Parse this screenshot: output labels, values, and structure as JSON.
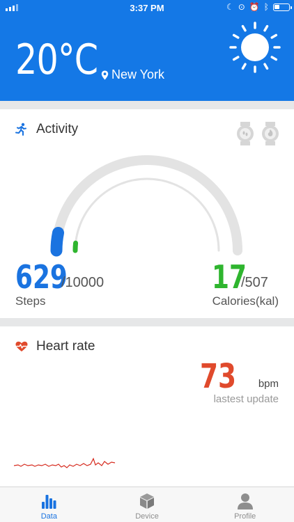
{
  "status_bar": {
    "time": "3:37 PM"
  },
  "weather": {
    "temperature": "20°C",
    "city": "New York"
  },
  "activity": {
    "title": "Activity",
    "steps": {
      "value": "629",
      "goal": "/10000",
      "label": "Steps",
      "progress": 0.0629
    },
    "calories": {
      "value": "17",
      "goal": "/507",
      "label": "Calories(kal)",
      "progress": 0.0335
    },
    "colors": {
      "steps": "#1a73e0",
      "calories": "#2fb52f",
      "track": "#e3e3e3"
    }
  },
  "heart_rate": {
    "title": "Heart rate",
    "value": "73",
    "unit": "bpm",
    "subtitle": "lastest update",
    "color": "#e04a2c"
  },
  "tabbar": {
    "tabs": [
      {
        "label": "Data",
        "icon": "bar-chart-icon",
        "active": true
      },
      {
        "label": "Device",
        "icon": "cube-icon",
        "active": false
      },
      {
        "label": "Profile",
        "icon": "person-icon",
        "active": false
      }
    ]
  },
  "colors": {
    "header": "#1478e6",
    "accent": "#1a73e0"
  }
}
